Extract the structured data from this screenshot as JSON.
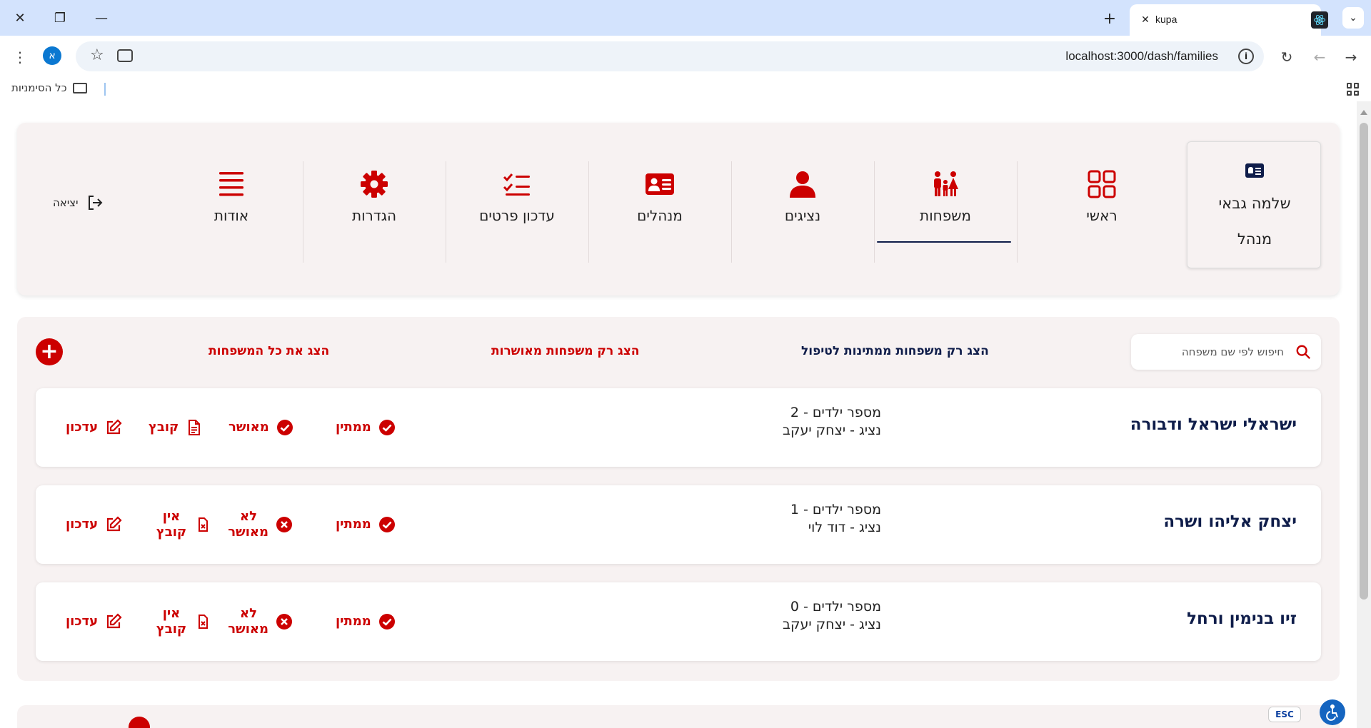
{
  "browser": {
    "tab_title": "kupa",
    "url": "localhost:3000/dash/families",
    "profile_initial": "א",
    "bookmarks_label": "כל הסימניות"
  },
  "profile": {
    "name": "שלמה גבאי",
    "role": "מנהל"
  },
  "nav": {
    "items": [
      {
        "label": "ראשי",
        "icon": "grid-icon"
      },
      {
        "label": "משפחות",
        "icon": "family-icon",
        "active": true
      },
      {
        "label": "נציגים",
        "icon": "person-icon"
      },
      {
        "label": "מנהלים",
        "icon": "id-card-icon"
      },
      {
        "label": "עדכון פרטים",
        "icon": "checklist-icon"
      },
      {
        "label": "הגדרות",
        "icon": "gear-icon"
      },
      {
        "label": "אודות",
        "icon": "menu-lines-icon"
      }
    ],
    "logout_label": "יציאה"
  },
  "families_section": {
    "search_placeholder": "חיפוש לפי שם משפחה",
    "filter_pending": "הצג רק משפחות ממתינות לטיפול",
    "filter_approved": "הצג רק משפחות מאושרות",
    "filter_all": "הצג את כל המשפחות"
  },
  "families": [
    {
      "name": "ישראלי ישראל ודבורה",
      "children": "מספר ילדים - 2",
      "rep": "נציג - יצחק יעקב",
      "waiting": "ממתין",
      "approval": "מאושר",
      "approved": true,
      "file": "קובץ",
      "has_file": true,
      "edit": "עדכון"
    },
    {
      "name": "יצחק אליהו ושרה",
      "children": "מספר ילדים - 1",
      "rep": "נציג - דוד לוי",
      "waiting": "ממתין",
      "approval": "לא מאושר",
      "approved": false,
      "file": "אין קובץ",
      "has_file": false,
      "edit": "עדכון"
    },
    {
      "name": "זיו בנימין ורחל",
      "children": "מספר ילדים - 0",
      "rep": "נציג - יצחק יעקב",
      "waiting": "ממתין",
      "approval": "לא מאושר",
      "approved": false,
      "file": "אין קובץ",
      "has_file": false,
      "edit": "עדכון"
    }
  ],
  "footer": {
    "esc_label": "ESC"
  },
  "colors": {
    "accent_red": "#cc0000",
    "navy": "#0f1d4a",
    "panel_bg": "#f7f2f2"
  }
}
